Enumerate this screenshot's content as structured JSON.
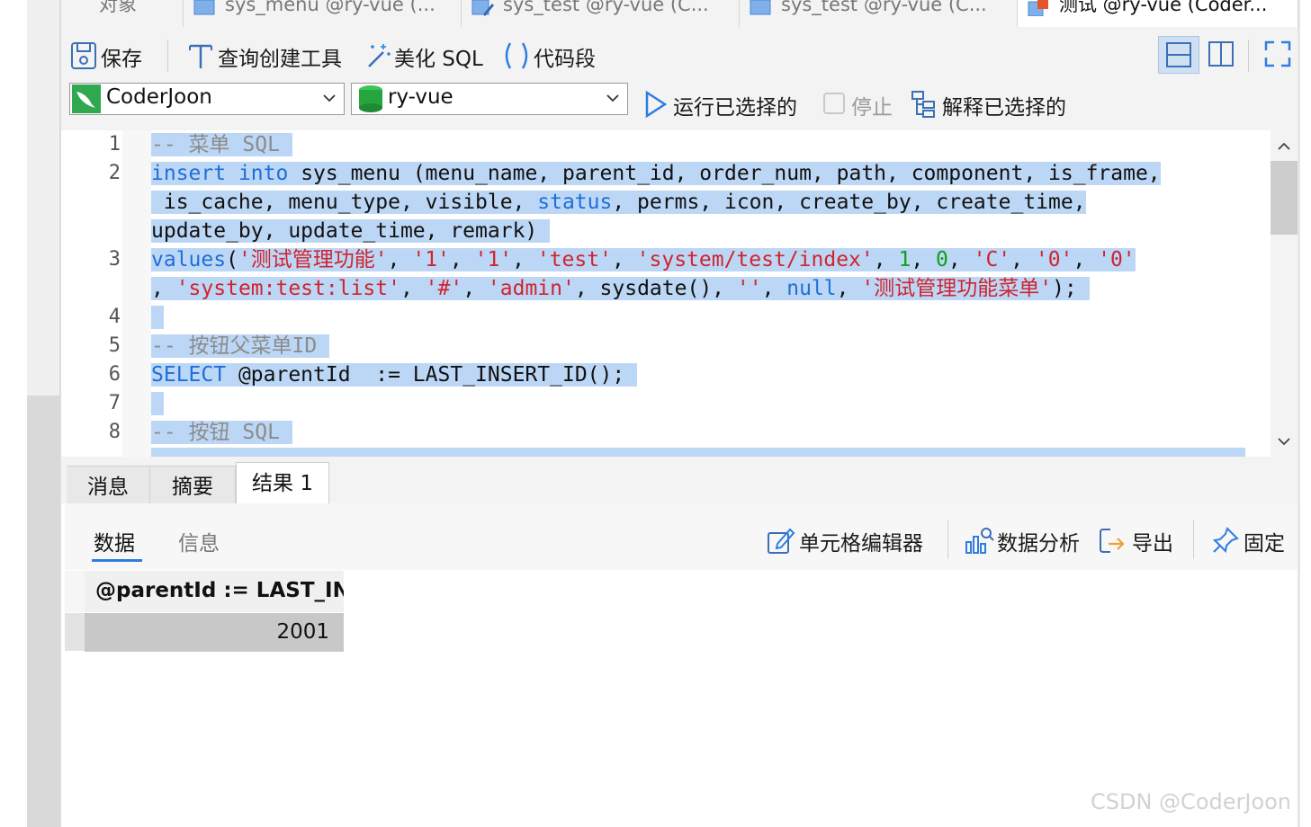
{
  "tabs": [
    {
      "label": "对象",
      "icon": "object-icon"
    },
    {
      "label": "sys_menu @ry-vue (...",
      "icon": "table-query-icon"
    },
    {
      "label": "sys_test @ry-vue (C...",
      "icon": "table-edit-icon"
    },
    {
      "label": "sys_test @ry-vue (C...",
      "icon": "table-query-icon"
    },
    {
      "label": "测试 @ry-vue (Coder...",
      "icon": "query-icon"
    }
  ],
  "toolbar": {
    "save": "保存",
    "query_builder": "查询创建工具",
    "beautify": "美化 SQL",
    "snippet": "代码段"
  },
  "connection": {
    "value": "CoderJoon",
    "icon": "mysql-dolphin-icon"
  },
  "database": {
    "value": "ry-vue",
    "icon": "database-icon"
  },
  "actions": {
    "run_selected": "运行已选择的",
    "stop": "停止",
    "explain_selected": "解释已选择的"
  },
  "editor": {
    "line_numbers": [
      "1",
      "2",
      "3",
      "4",
      "5",
      "6",
      "7",
      "8"
    ],
    "lines": {
      "l1": {
        "comment": "-- 菜单 SQL"
      },
      "l2a": {
        "kw1": "insert",
        "kw2": "into",
        "rest": " sys_menu (menu_name, parent_id, order_num, path, component, is_frame,"
      },
      "l2b": {
        "text1": " is_cache, menu_type, visible, ",
        "kw": "status",
        "text2": ", perms, icon, create_by, create_time,"
      },
      "l2c": {
        "text": "update_by, update_time, remark)"
      },
      "l3a": {
        "kw": "values",
        "p": "(",
        "s1": "'测试管理功能'",
        "c1": ", ",
        "s2": "'1'",
        "c2": ", ",
        "s3": "'1'",
        "c3": ", ",
        "s4": "'test'",
        "c4": ", ",
        "s5": "'system/test/index'",
        "c5": ", ",
        "n1": "1",
        "c6": ", ",
        "n2": "0",
        "c7": ", ",
        "s6": "'C'",
        "c8": ", ",
        "s7": "'0'",
        "c9": ", ",
        "s8": "'0'"
      },
      "l3b": {
        "c1": ", ",
        "s1": "'system:test:list'",
        "c2": ", ",
        "s2": "'#'",
        "c3": ", ",
        "s3": "'admin'",
        "c4": ", sysdate(), ",
        "s4": "''",
        "c5": ", ",
        "kw": "null",
        "c6": ", ",
        "s5": "'测试管理功能菜单'",
        "end": ");"
      },
      "l5": {
        "comment": "-- 按钮父菜单ID"
      },
      "l6": {
        "kw": "SELECT",
        "rest": " @parentId  := LAST_INSERT_ID();"
      },
      "l8": {
        "comment": "-- 按钮 SQL"
      }
    }
  },
  "bottom_tabs": {
    "messages": "消息",
    "summary": "摘要",
    "result1": "结果 1"
  },
  "result": {
    "subtabs": {
      "data": "数据",
      "info": "信息"
    },
    "tools": {
      "cell_editor": "单元格编辑器",
      "analysis": "数据分析",
      "export": "导出",
      "pin": "固定"
    },
    "columns": [
      "@parentId := LAST_IN"
    ],
    "rows": [
      [
        "2001"
      ]
    ]
  },
  "watermark": "CSDN @CoderJoon",
  "colors": {
    "keyword": "#1e6fd9",
    "string": "#d0242e",
    "number": "#11a01a",
    "comment": "#8b8b8b",
    "selection": "#bcd7f5",
    "accent": "#2f7de1"
  }
}
